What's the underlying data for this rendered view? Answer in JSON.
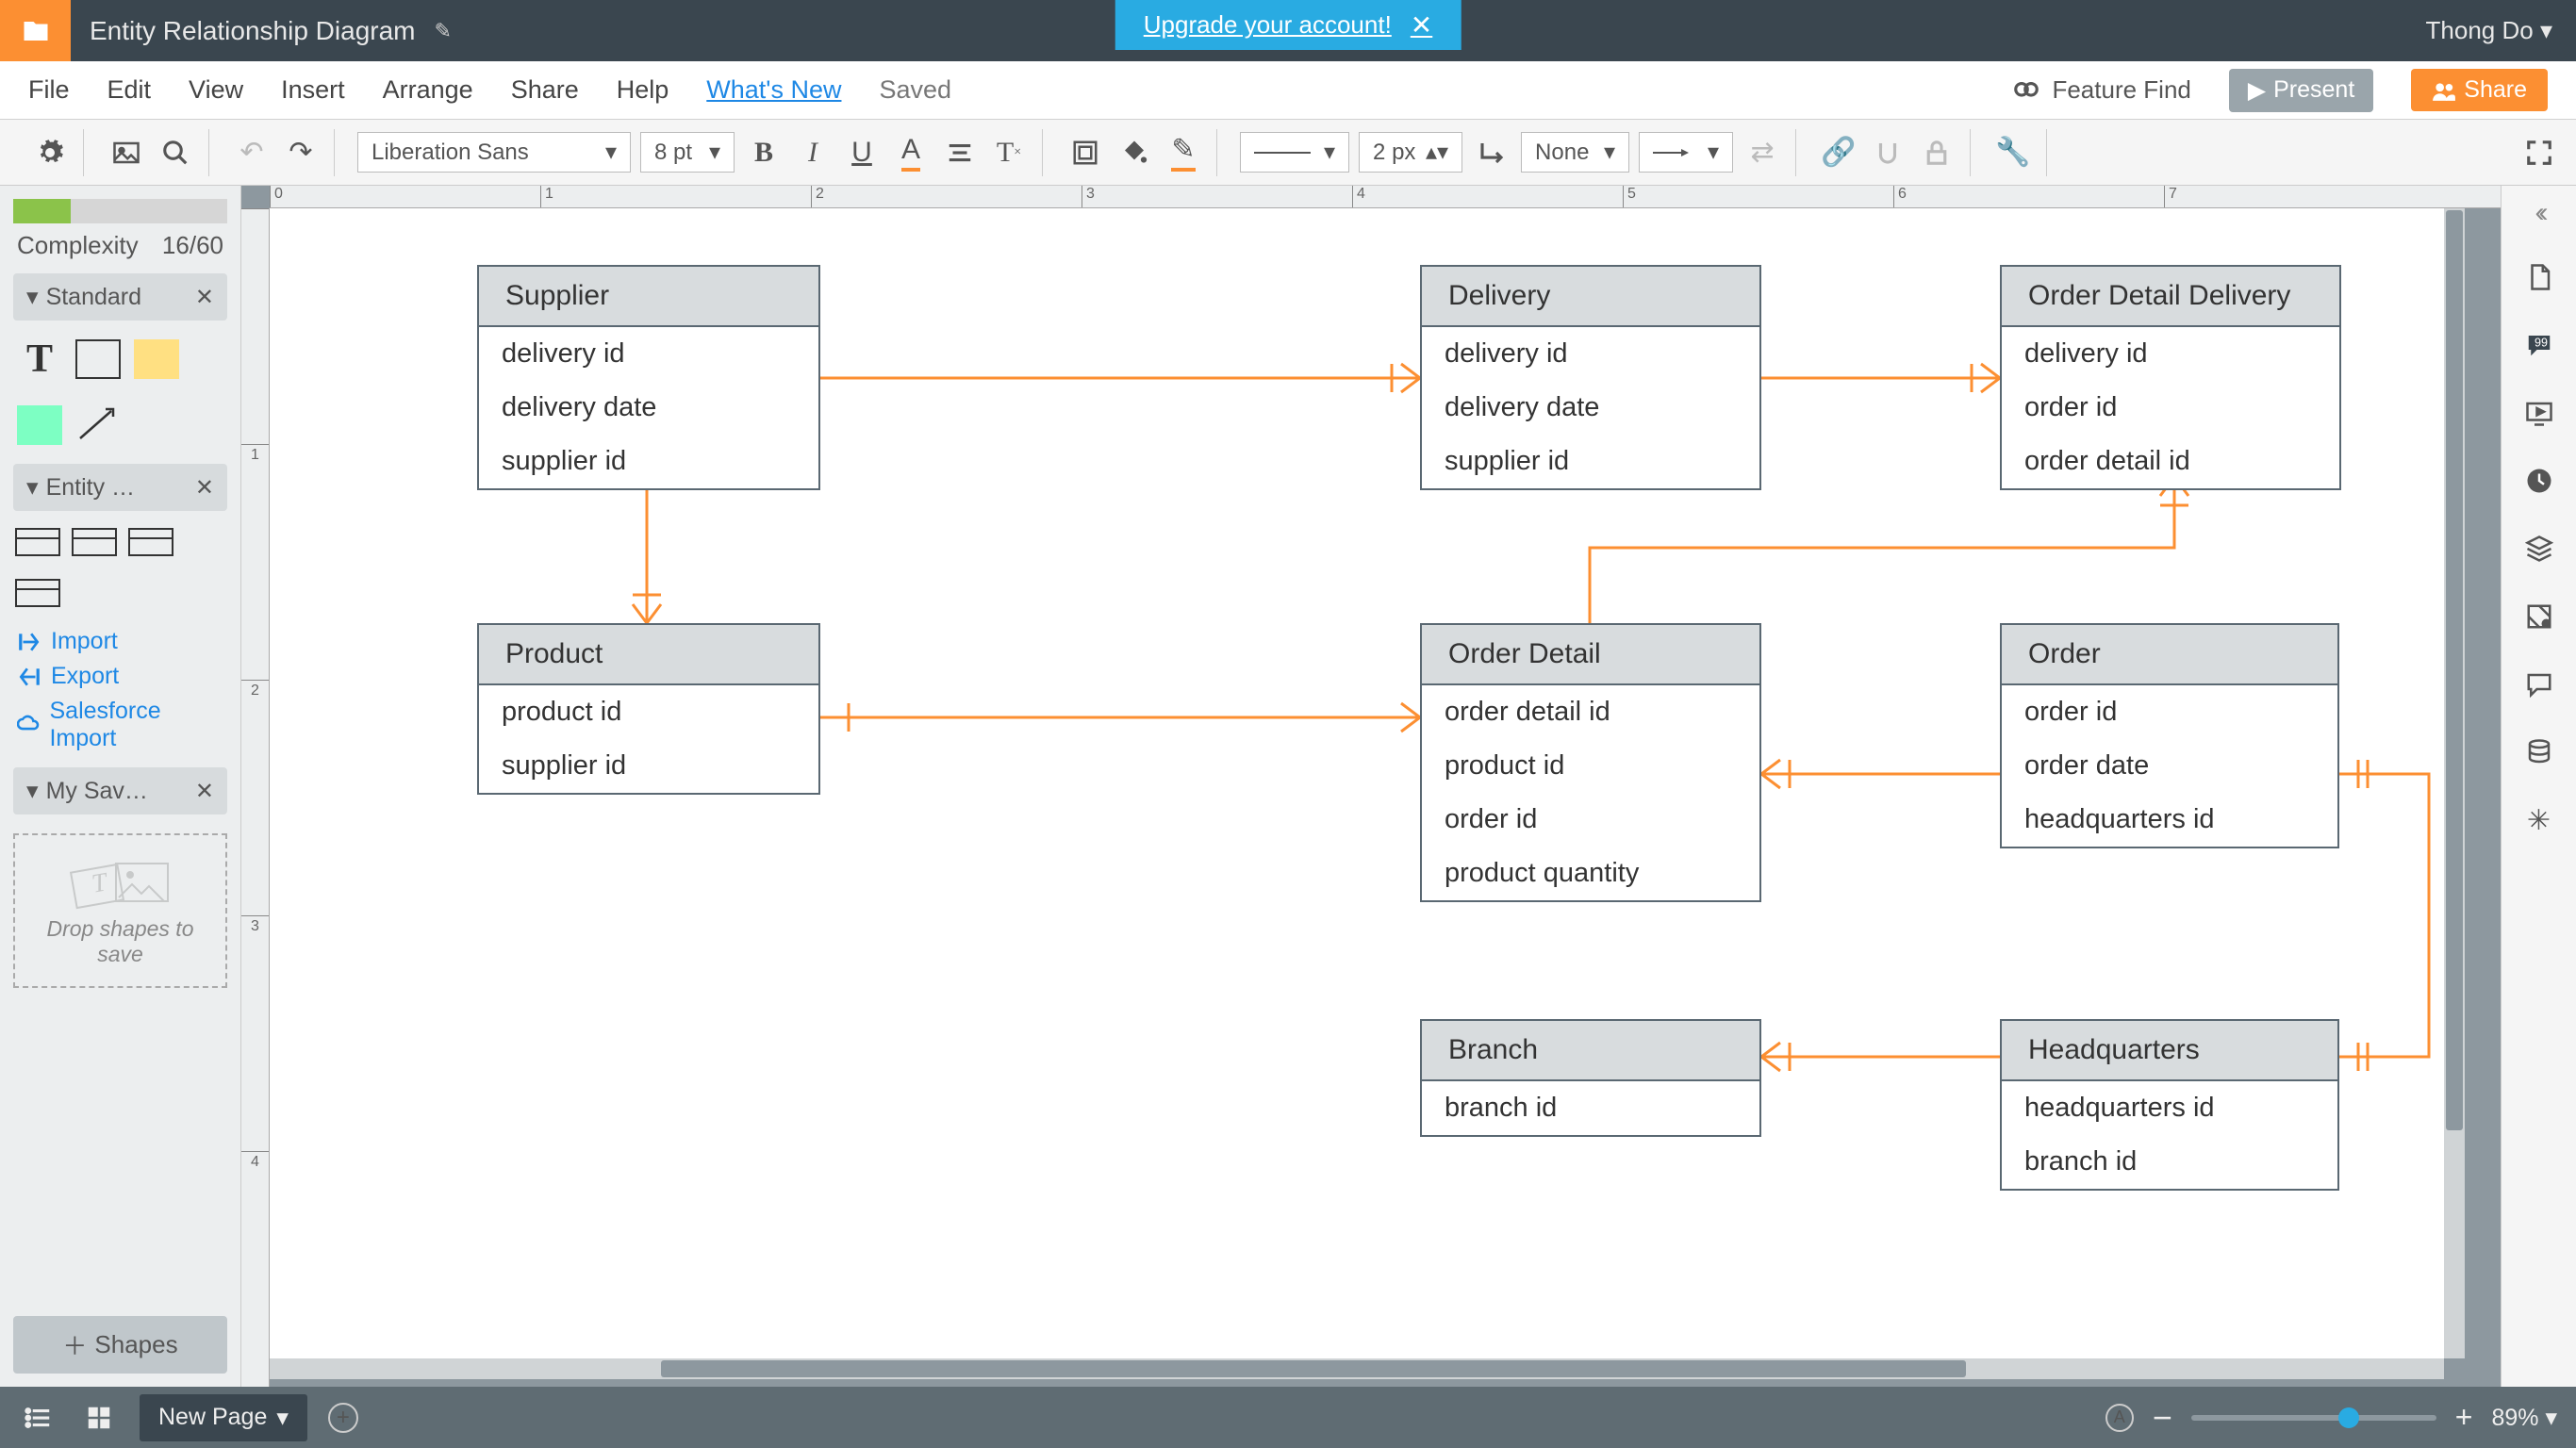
{
  "top": {
    "doc_title": "Entity Relationship Diagram",
    "upgrade": "Upgrade your account!",
    "user": "Thong Do"
  },
  "menu": {
    "file": "File",
    "edit": "Edit",
    "view": "View",
    "insert": "Insert",
    "arrange": "Arrange",
    "share": "Share",
    "help": "Help",
    "whatsnew": "What's New",
    "saved": "Saved",
    "feature_find": "Feature Find",
    "present": "Present",
    "share_btn": "Share"
  },
  "toolbar": {
    "font": "Liberation Sans",
    "fontsize": "8 pt",
    "line_width": "2 px",
    "line_style": "None"
  },
  "left": {
    "complexity_label": "Complexity",
    "complexity_value": "16/60",
    "lib_standard": "Standard",
    "lib_entity": "Entity …",
    "import": "Import",
    "export": "Export",
    "salesforce": "Salesforce Import",
    "my_saved": "My Sav…",
    "dropzone": "Drop shapes to save",
    "shapes_btn": "Shapes"
  },
  "entities": {
    "supplier": {
      "title": "Supplier",
      "rows": [
        "delivery id",
        "delivery date",
        "supplier id"
      ]
    },
    "delivery": {
      "title": "Delivery",
      "rows": [
        "delivery id",
        "delivery date",
        "supplier id"
      ]
    },
    "odd": {
      "title": "Order Detail Delivery",
      "rows": [
        "delivery id",
        "order id",
        "order detail id"
      ]
    },
    "product": {
      "title": "Product",
      "rows": [
        "product id",
        "supplier id"
      ]
    },
    "orderdetail": {
      "title": "Order Detail",
      "rows": [
        "order detail id",
        "product id",
        "order id",
        "product quantity"
      ]
    },
    "order": {
      "title": "Order",
      "rows": [
        "order id",
        "order date",
        "headquarters id"
      ]
    },
    "branch": {
      "title": "Branch",
      "rows": [
        "branch id"
      ]
    },
    "hq": {
      "title": "Headquarters",
      "rows": [
        "headquarters id",
        "branch id"
      ]
    }
  },
  "bottom": {
    "page": "New Page",
    "zoom": "89%"
  },
  "chart_data": {
    "type": "erd",
    "entities": [
      {
        "name": "Supplier",
        "attrs": [
          "delivery id",
          "delivery date",
          "supplier id"
        ]
      },
      {
        "name": "Delivery",
        "attrs": [
          "delivery id",
          "delivery date",
          "supplier id"
        ]
      },
      {
        "name": "Order Detail Delivery",
        "attrs": [
          "delivery id",
          "order id",
          "order detail id"
        ]
      },
      {
        "name": "Product",
        "attrs": [
          "product id",
          "supplier id"
        ]
      },
      {
        "name": "Order Detail",
        "attrs": [
          "order detail id",
          "product id",
          "order id",
          "product quantity"
        ]
      },
      {
        "name": "Order",
        "attrs": [
          "order id",
          "order date",
          "headquarters id"
        ]
      },
      {
        "name": "Branch",
        "attrs": [
          "branch id"
        ]
      },
      {
        "name": "Headquarters",
        "attrs": [
          "headquarters id",
          "branch id"
        ]
      }
    ],
    "relationships": [
      {
        "from": "Supplier",
        "to": "Delivery",
        "card_from": "one",
        "card_to": "many"
      },
      {
        "from": "Delivery",
        "to": "Order Detail Delivery",
        "card_from": "one",
        "card_to": "many"
      },
      {
        "from": "Supplier",
        "to": "Product",
        "card_from": "one",
        "card_to": "many"
      },
      {
        "from": "Product",
        "to": "Order Detail",
        "card_from": "one",
        "card_to": "many"
      },
      {
        "from": "Order Detail",
        "to": "Order",
        "card_from": "many",
        "card_to": "one"
      },
      {
        "from": "Order Detail Delivery",
        "to": "Order Detail",
        "card_from": "one",
        "card_to": "one"
      },
      {
        "from": "Order",
        "to": "Headquarters",
        "card_from": "many",
        "card_to": "one"
      },
      {
        "from": "Branch",
        "to": "Headquarters",
        "card_from": "many",
        "card_to": "one"
      }
    ]
  }
}
